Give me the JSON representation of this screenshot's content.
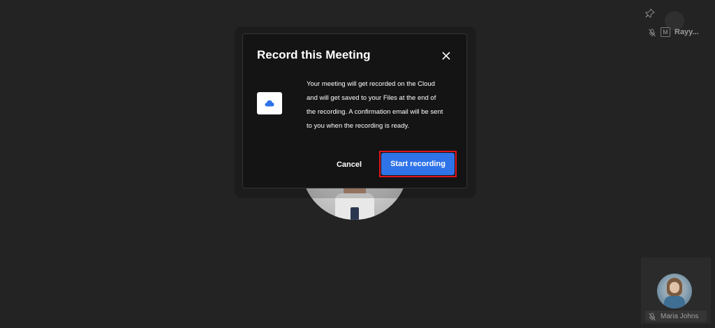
{
  "modal": {
    "title": "Record this Meeting",
    "description": "Your meeting will get recorded on the Cloud and will get saved to your Files at the end of the recording. A confirmation email will be sent to you when the recording is ready.",
    "cancel_label": "Cancel",
    "start_label": "Start recording",
    "icons": {
      "close": "close-icon",
      "cloud": "cloud-icon"
    },
    "colors": {
      "primary_button": "#2f73e8",
      "highlight_outline": "#e0151c",
      "cloud_icon": "#2f73e8"
    }
  },
  "participants": {
    "top_right": {
      "name": "Rayy...",
      "badge": "M",
      "icons": [
        "pin-icon",
        "mic-off-icon"
      ]
    },
    "bottom_right": {
      "name": "Maria Johns",
      "icons": [
        "mic-off-icon"
      ]
    }
  }
}
